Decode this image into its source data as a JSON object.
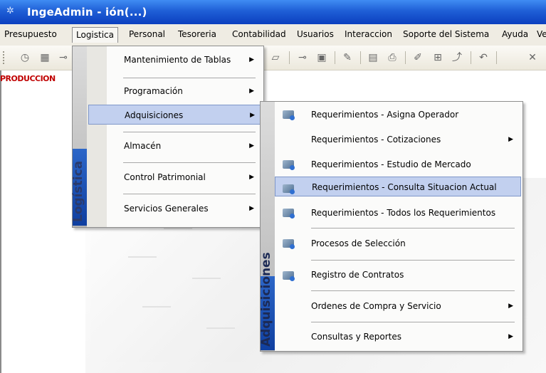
{
  "window": {
    "title": "IngeAdmin -  ión(...)",
    "icon": "app-icon"
  },
  "menubar": {
    "items": [
      "Presupuesto",
      "Logistica",
      "Personal",
      "Tesoreria",
      "Contabilidad",
      "Usuarios",
      "Interaccion",
      "Soporte del Sistema",
      "Ayuda",
      "Ve"
    ],
    "active": "Logistica"
  },
  "toolbar": {
    "icons": [
      "clock-icon",
      "calendar-icon",
      "key-icon",
      "document-icon",
      "key-alt-icon",
      "save-icon",
      "edit-icon",
      "preview-icon",
      "print-icon",
      "pen-icon",
      "grid-icon",
      "export-icon",
      "undo-icon",
      "close-icon"
    ]
  },
  "status_text": "PRODUCCION",
  "logistica_menu": {
    "side_label": "Logística",
    "items": [
      {
        "label": "Mantenimiento de Tablas",
        "submenu": true
      },
      {
        "label": "Programación",
        "submenu": true
      },
      {
        "label": "Adquisiciones",
        "submenu": true,
        "highlighted": true
      },
      {
        "label": "Almacén",
        "submenu": true
      },
      {
        "label": "Control Patrimonial",
        "submenu": true
      },
      {
        "label": "Servicios Generales",
        "submenu": true
      }
    ]
  },
  "adquisiciones_menu": {
    "side_label": "Adquisiciones",
    "items": [
      {
        "label": "Requerimientos - Asigna Operador",
        "icon": "form-icon",
        "submenu": false
      },
      {
        "label": "Requerimientos - Cotizaciones",
        "icon": "",
        "submenu": true
      },
      {
        "label": "Requerimientos - Estudio de Mercado",
        "icon": "form-icon",
        "submenu": false
      },
      {
        "label": "Requerimientos - Consulta Situacion Actual",
        "icon": "form-icon",
        "submenu": false,
        "highlighted": true
      },
      {
        "label": "Requerimientos - Todos los Requerimientos",
        "icon": "form-icon",
        "submenu": false
      },
      {
        "label": "Procesos de Selección",
        "icon": "form-icon",
        "submenu": false
      },
      {
        "label": "Registro de Contratos",
        "icon": "form-icon",
        "submenu": false
      },
      {
        "label": "Ordenes de Compra y Servicio",
        "icon": "",
        "submenu": true
      },
      {
        "label": "Consultas y Reportes",
        "icon": "",
        "submenu": true
      }
    ]
  },
  "colors": {
    "titlebar": "#1f5fd6",
    "highlight": "#c2d0ef",
    "side_blue": "#0f3fa0",
    "status_text": "#c00000"
  }
}
